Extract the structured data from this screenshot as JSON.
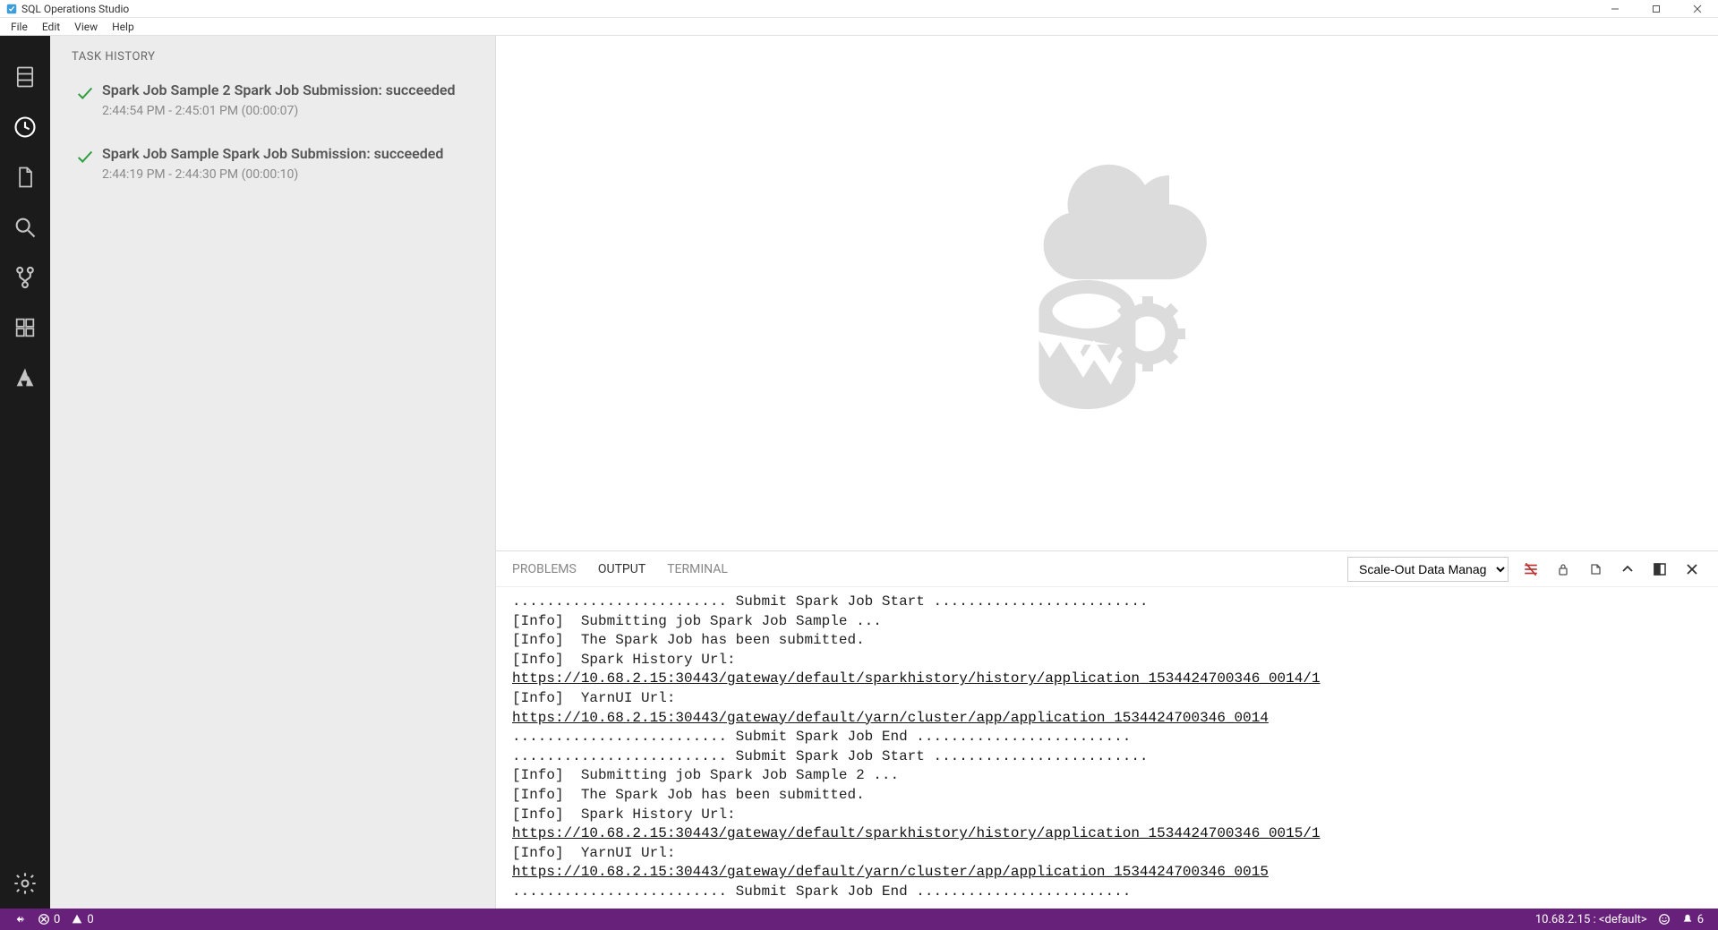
{
  "title": "SQL Operations Studio",
  "menubar": [
    "File",
    "Edit",
    "View",
    "Help"
  ],
  "activitybar": {
    "items": [
      {
        "name": "servers",
        "icon": "server-icon"
      },
      {
        "name": "task-history",
        "icon": "clock-icon",
        "active": true
      },
      {
        "name": "explorer",
        "icon": "file-icon"
      },
      {
        "name": "search",
        "icon": "search-icon"
      },
      {
        "name": "source-control",
        "icon": "branch-icon"
      },
      {
        "name": "extensions",
        "icon": "extensions-icon"
      },
      {
        "name": "azure",
        "icon": "azure-icon"
      }
    ],
    "bottom": [
      {
        "name": "settings-gear",
        "icon": "gear-icon"
      }
    ]
  },
  "sidebar": {
    "section_title": "TASK HISTORY",
    "tasks": [
      {
        "title": "Spark Job Sample 2 Spark Job Submission: succeeded",
        "time": "2:44:54 PM - 2:45:01 PM (00:00:07)"
      },
      {
        "title": "Spark Job Sample Spark Job Submission: succeeded",
        "time": "2:44:19 PM - 2:44:30 PM (00:00:10)"
      }
    ]
  },
  "panel": {
    "tabs": [
      "PROBLEMS",
      "OUTPUT",
      "TERMINAL"
    ],
    "active_tab": "OUTPUT",
    "output_channel": "Scale-Out Data Manag",
    "output_lines": [
      {
        "t": "text",
        "v": "......................... Submit Spark Job Start ........................."
      },
      {
        "t": "text",
        "v": "[Info]  Submitting job Spark Job Sample ..."
      },
      {
        "t": "text",
        "v": "[Info]  The Spark Job has been submitted."
      },
      {
        "t": "text",
        "v": "[Info]  Spark History Url:"
      },
      {
        "t": "url",
        "v": "https://10.68.2.15:30443/gateway/default/sparkhistory/history/application_1534424700346_0014/1"
      },
      {
        "t": "text",
        "v": "[Info]  YarnUI Url:"
      },
      {
        "t": "url",
        "v": "https://10.68.2.15:30443/gateway/default/yarn/cluster/app/application_1534424700346_0014"
      },
      {
        "t": "text",
        "v": "......................... Submit Spark Job End ........................."
      },
      {
        "t": "text",
        "v": "......................... Submit Spark Job Start ........................."
      },
      {
        "t": "text",
        "v": "[Info]  Submitting job Spark Job Sample 2 ..."
      },
      {
        "t": "text",
        "v": "[Info]  The Spark Job has been submitted."
      },
      {
        "t": "text",
        "v": "[Info]  Spark History Url:"
      },
      {
        "t": "url",
        "v": "https://10.68.2.15:30443/gateway/default/sparkhistory/history/application_1534424700346_0015/1"
      },
      {
        "t": "text",
        "v": "[Info]  YarnUI Url:"
      },
      {
        "t": "url",
        "v": "https://10.68.2.15:30443/gateway/default/yarn/cluster/app/application_1534424700346_0015"
      },
      {
        "t": "text",
        "v": "......................... Submit Spark Job End ........................."
      }
    ]
  },
  "statusbar": {
    "errors": "0",
    "warnings": "0",
    "connection": "10.68.2.15 : <default>",
    "notifications": "6"
  }
}
